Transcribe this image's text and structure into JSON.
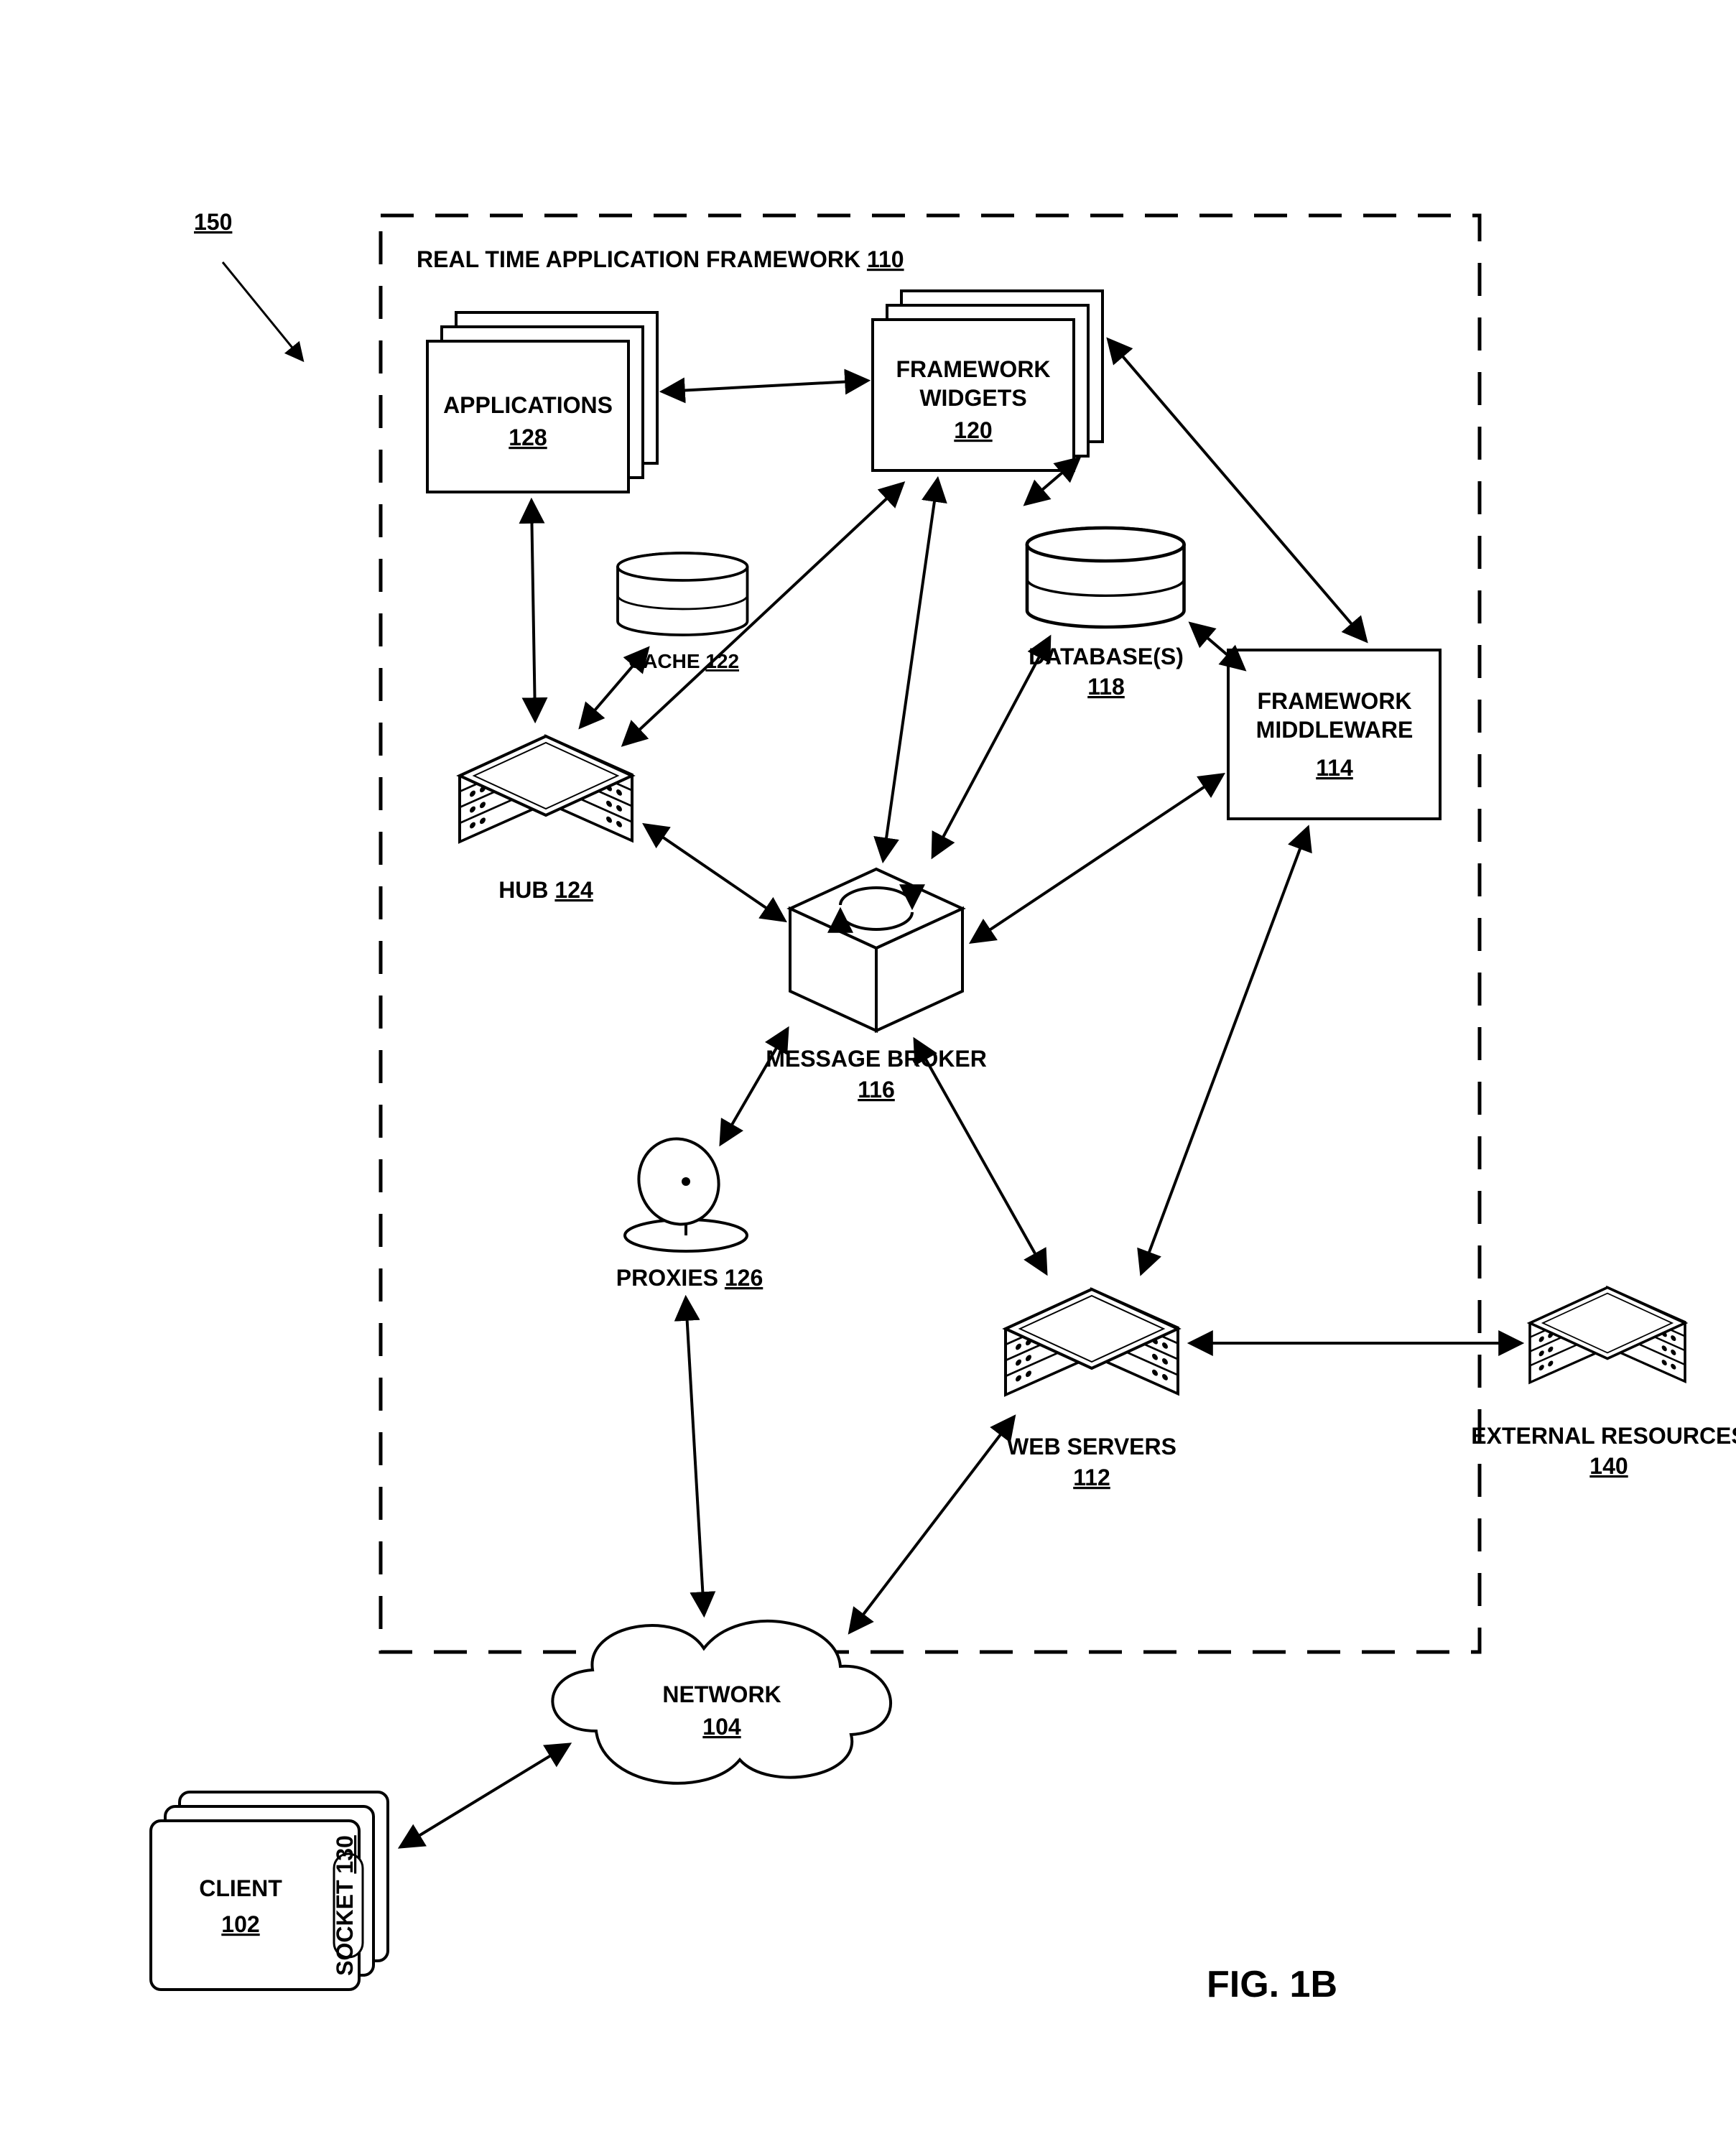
{
  "figure_ref": "150",
  "figure_caption": "FIG. 1B",
  "framework": {
    "title": "REAL TIME APPLICATION FRAMEWORK",
    "ref": "110"
  },
  "nodes": {
    "applications": {
      "label": "APPLICATIONS",
      "ref": "128"
    },
    "widgets": {
      "label1": "FRAMEWORK",
      "label2": "WIDGETS",
      "ref": "120"
    },
    "cache": {
      "label": "CACHE",
      "ref": "122"
    },
    "hub": {
      "label": "HUB",
      "ref": "124"
    },
    "database": {
      "label": "DATABASE(S)",
      "ref": "118"
    },
    "middleware": {
      "label1": "FRAMEWORK",
      "label2": "MIDDLEWARE",
      "ref": "114"
    },
    "broker": {
      "label": "MESSAGE BROKER",
      "ref": "116"
    },
    "proxies": {
      "label": "PROXIES",
      "ref": "126"
    },
    "webservers": {
      "label": "WEB SERVERS",
      "ref": "112"
    },
    "external": {
      "label": "EXTERNAL RESOURCES",
      "ref": "140"
    },
    "network": {
      "label": "NETWORK",
      "ref": "104"
    },
    "client": {
      "label": "CLIENT",
      "ref": "102",
      "socket_label": "SOCKET",
      "socket_ref": "130"
    }
  }
}
